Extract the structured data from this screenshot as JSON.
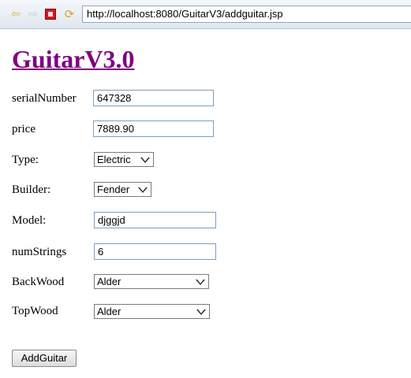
{
  "browser": {
    "url": "http://localhost:8080/GuitarV3/addguitar.jsp"
  },
  "page": {
    "title": "GuitarV3.0"
  },
  "form": {
    "serial_number": {
      "label": "serialNumber",
      "value": "647328"
    },
    "price": {
      "label": "price",
      "value": "7889.90"
    },
    "type": {
      "label": "Type:",
      "value": "Electric"
    },
    "builder": {
      "label": "Builder:",
      "value": "Fender"
    },
    "model": {
      "label": "Model:",
      "value": "djggjd"
    },
    "num_strings": {
      "label": "numStrings",
      "value": "6"
    },
    "back_wood": {
      "label": "BackWood",
      "value": "Alder"
    },
    "top_wood": {
      "label": "TopWood",
      "value": "Alder"
    },
    "submit_label": "AddGuitar"
  }
}
